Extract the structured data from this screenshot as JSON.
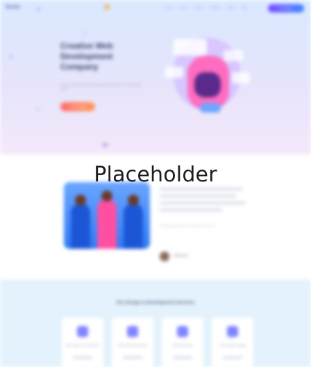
{
  "nav": {
    "logo": "Dacita",
    "menu": [
      "Home",
      "About",
      "Service",
      "Portfolio",
      "Pages",
      "Blog"
    ],
    "cta": "Get Started"
  },
  "hero": {
    "title": "Creative Web Development Company",
    "subtitle": "We build modern websites and apps that help your business grow online.",
    "cta": "Get Started"
  },
  "overlay": {
    "text": "Placeholder"
  },
  "about": {
    "caption": "Working together with our clients for success.",
    "author": "John Doe"
  },
  "services": {
    "title": "Our Design & Development Services",
    "cards": [
      {
        "label": "Web Design & Development"
      },
      {
        "label": "Mobile App Development"
      },
      {
        "label": "Digital Marketing"
      },
      {
        "label": "UI/UX Design Strategy"
      }
    ]
  },
  "colors": {
    "hero_bg_top": "#d9e9ff",
    "hero_bg_bottom": "#f4e8fb",
    "accent": "#7b4dff",
    "cta_gradient_start": "#ff6b6b",
    "cta_gradient_end": "#ff9a5a",
    "services_bg": "#e3f2fc"
  }
}
